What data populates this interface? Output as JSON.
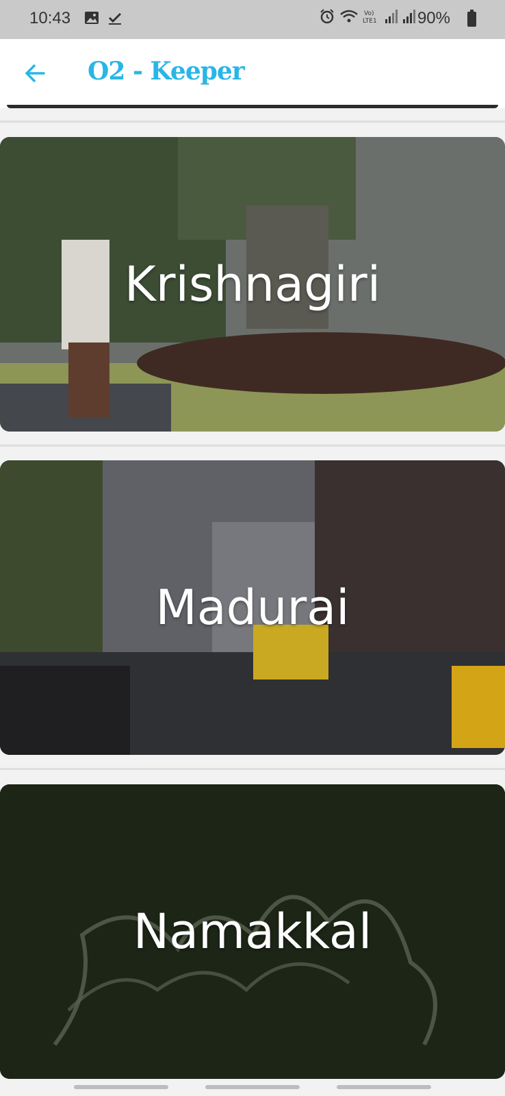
{
  "status_bar": {
    "time": "10:43",
    "battery": "90%",
    "left_icons": [
      "image-icon",
      "check-icon"
    ],
    "right_icons": [
      "alarm-icon",
      "wifi-icon",
      "volte-icon",
      "signal-icon",
      "signal-icon"
    ]
  },
  "app_bar": {
    "title": "O2 - Keeper",
    "back_icon": "arrow-left-icon",
    "accent": "#29b6e6"
  },
  "cities": [
    {
      "name": "Krishnagiri"
    },
    {
      "name": "Madurai"
    },
    {
      "name": "Namakkal"
    }
  ]
}
